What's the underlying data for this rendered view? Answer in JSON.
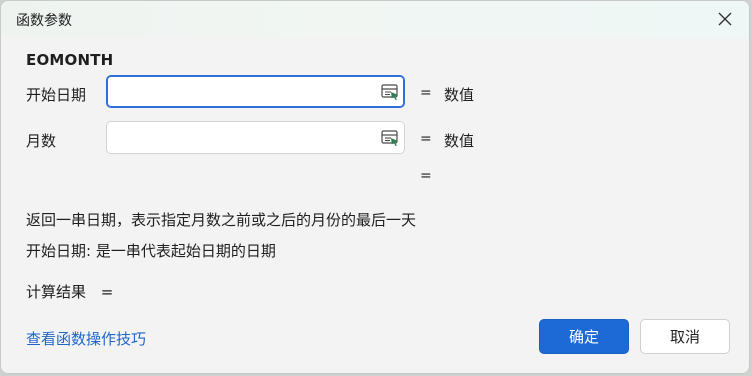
{
  "dialog": {
    "title": "函数参数",
    "function_name": "EOMONTH"
  },
  "args": [
    {
      "label": "开始日期",
      "value": "",
      "equals": "=",
      "result": "数值",
      "ref_icon": "range-select-icon"
    },
    {
      "label": "月数",
      "value": "",
      "equals": "=",
      "result": "数值",
      "ref_icon": "range-select-icon"
    }
  ],
  "function_result_equals": "=",
  "description": "返回一串日期，表示指定月数之前或之后的月份的最后一天",
  "arg_description": "开始日期:  是一串代表起始日期的日期",
  "calc_result": {
    "label": "计算结果",
    "equals": "="
  },
  "help_link": "查看函数操作技巧",
  "buttons": {
    "ok": "确定",
    "cancel": "取消"
  },
  "colors": {
    "accent": "#1d6ad6",
    "link": "#1f66c9",
    "focus_border": "#2f6fd6",
    "icon_green": "#2e7d4f"
  }
}
